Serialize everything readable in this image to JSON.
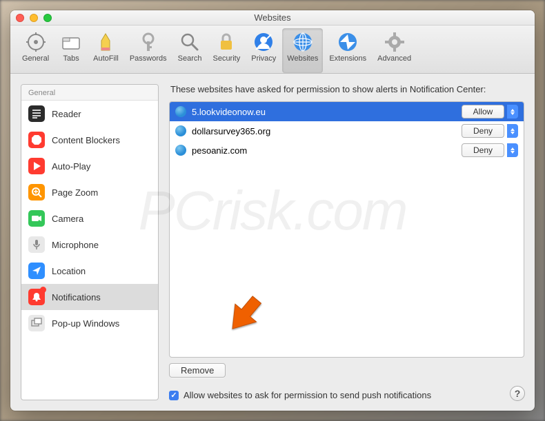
{
  "window": {
    "title": "Websites"
  },
  "toolbar": [
    {
      "name": "general",
      "label": "General",
      "selected": false
    },
    {
      "name": "tabs",
      "label": "Tabs",
      "selected": false
    },
    {
      "name": "autofill",
      "label": "AutoFill",
      "selected": false
    },
    {
      "name": "passwords",
      "label": "Passwords",
      "selected": false
    },
    {
      "name": "search",
      "label": "Search",
      "selected": false
    },
    {
      "name": "security",
      "label": "Security",
      "selected": false
    },
    {
      "name": "privacy",
      "label": "Privacy",
      "selected": false
    },
    {
      "name": "websites",
      "label": "Websites",
      "selected": true
    },
    {
      "name": "extensions",
      "label": "Extensions",
      "selected": false
    },
    {
      "name": "advanced",
      "label": "Advanced",
      "selected": false
    }
  ],
  "sidebar": {
    "header": "General",
    "items": [
      {
        "name": "reader",
        "label": "Reader",
        "color": "#2b2b2b"
      },
      {
        "name": "content-blockers",
        "label": "Content Blockers",
        "color": "#ff3b30"
      },
      {
        "name": "auto-play",
        "label": "Auto-Play",
        "color": "#ff3b30"
      },
      {
        "name": "page-zoom",
        "label": "Page Zoom",
        "color": "#ff9500"
      },
      {
        "name": "camera",
        "label": "Camera",
        "color": "#34c759"
      },
      {
        "name": "microphone",
        "label": "Microphone",
        "color": "#d0d0d0"
      },
      {
        "name": "location",
        "label": "Location",
        "color": "#2f8fff"
      },
      {
        "name": "notifications",
        "label": "Notifications",
        "color": "#ff3b30",
        "selected": true,
        "badge": true
      },
      {
        "name": "popup-windows",
        "label": "Pop-up Windows",
        "color": "#d0d0d0"
      }
    ]
  },
  "content": {
    "description": "These websites have asked for permission to show alerts in Notification Center:",
    "rows": [
      {
        "site": "5.lookvideonow.eu",
        "permission": "Allow",
        "selected": true
      },
      {
        "site": "dollarsurvey365.org",
        "permission": "Deny",
        "selected": false
      },
      {
        "site": "pesoaniz.com",
        "permission": "Deny",
        "selected": false
      }
    ],
    "remove_label": "Remove",
    "checkbox_label": "Allow websites to ask for permission to send push notifications",
    "checkbox_checked": true
  },
  "help_label": "?"
}
